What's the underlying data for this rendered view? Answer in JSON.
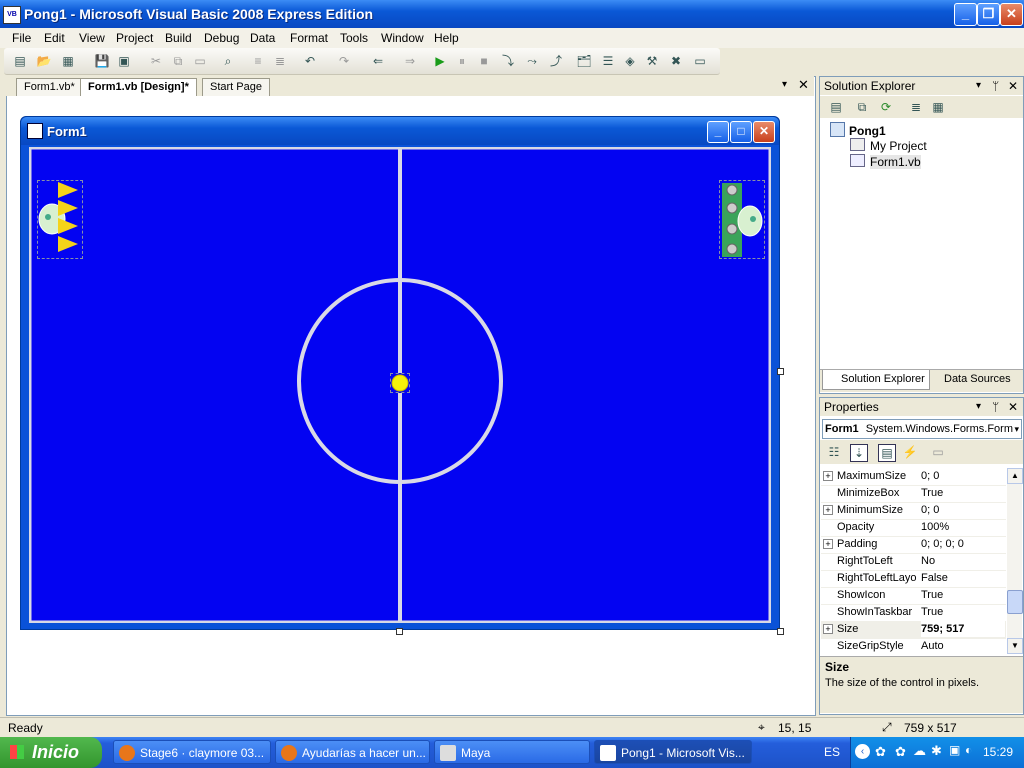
{
  "window": {
    "title": "Pong1 - Microsoft Visual Basic 2008 Express Edition",
    "app_icon_label": "VB"
  },
  "menu": [
    "File",
    "Edit",
    "View",
    "Project",
    "Build",
    "Debug",
    "Data",
    "Format",
    "Tools",
    "Window",
    "Help"
  ],
  "doc_tabs": [
    {
      "label": "Form1.vb*",
      "active": false
    },
    {
      "label": "Form1.vb [Design]*",
      "active": true
    },
    {
      "label": "Start Page",
      "active": false
    }
  ],
  "form": {
    "title": "Form1",
    "field_color": "#0303f2"
  },
  "solution_explorer": {
    "title": "Solution Explorer",
    "project": "Pong1",
    "items": [
      "My Project",
      "Form1.vb"
    ],
    "bottom_tabs": [
      "Solution Explorer",
      "Data Sources"
    ]
  },
  "properties": {
    "title": "Properties",
    "object_name": "Form1",
    "object_type": "System.Windows.Forms.Form",
    "rows": [
      {
        "name": "MaximumSize",
        "value": "0; 0",
        "expandable": true,
        "bold": false
      },
      {
        "name": "MinimizeBox",
        "value": "True",
        "expandable": false,
        "bold": false
      },
      {
        "name": "MinimumSize",
        "value": "0; 0",
        "expandable": true,
        "bold": false
      },
      {
        "name": "Opacity",
        "value": "100%",
        "expandable": false,
        "bold": false
      },
      {
        "name": "Padding",
        "value": "0; 0; 0; 0",
        "expandable": true,
        "bold": false
      },
      {
        "name": "RightToLeft",
        "value": "No",
        "expandable": false,
        "bold": false
      },
      {
        "name": "RightToLeftLayo",
        "value": "False",
        "expandable": false,
        "bold": false
      },
      {
        "name": "ShowIcon",
        "value": "True",
        "expandable": false,
        "bold": false
      },
      {
        "name": "ShowInTaskbar",
        "value": "True",
        "expandable": false,
        "bold": false
      },
      {
        "name": "Size",
        "value": "759; 517",
        "expandable": true,
        "bold": true
      },
      {
        "name": "SizeGripStyle",
        "value": "Auto",
        "expandable": false,
        "bold": false
      }
    ],
    "description_title": "Size",
    "description_text": "The size of the control in pixels."
  },
  "status": {
    "text": "Ready",
    "position": "15, 15",
    "size": "759 x 517"
  },
  "taskbar": {
    "start_label": "Inicio",
    "tasks": [
      {
        "label": "Stage6 · claymore 03...",
        "active": false
      },
      {
        "label": "Ayudarías a hacer un...",
        "active": false
      },
      {
        "label": "Maya",
        "active": false
      },
      {
        "label": "Pong1 - Microsoft Vis...",
        "active": true
      }
    ],
    "language": "ES",
    "clock": "15:29"
  },
  "colors": {
    "xp_blue": "#0a58d6",
    "field_blue": "#0303f2",
    "ball": "#f5f20a",
    "paddle_triangles": "#f5d31a"
  }
}
